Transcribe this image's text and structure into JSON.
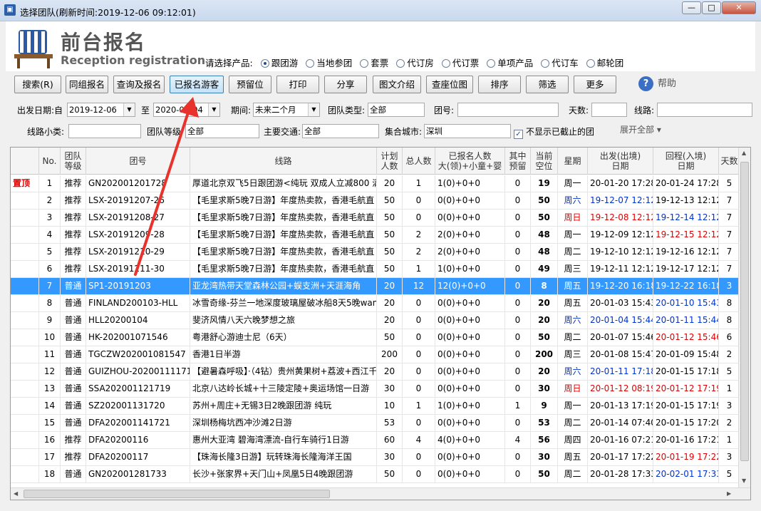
{
  "window": {
    "title": "选择团队(刷新时间:2019-12-06   09:12:01)",
    "min": "—",
    "max": "□",
    "close": "✕"
  },
  "header": {
    "title": "前台报名",
    "subtitle": "Reception registration",
    "product_label": "请选择产品:",
    "products": [
      "跟团游",
      "当地参团",
      "套票",
      "代订房",
      "代订票",
      "单项产品",
      "代订车",
      "邮轮团"
    ]
  },
  "toolbar": {
    "buttons": [
      "搜索(R)",
      "同组报名",
      "查询及报名",
      "已报名游客",
      "预留位",
      "打印",
      "分享",
      "图文介绍",
      "查座位图",
      "排序",
      "筛选",
      "更多"
    ],
    "help": "帮助"
  },
  "filters": {
    "depart_label": "出发日期:自",
    "date_from": "2019-12-06",
    "to_label": "至",
    "date_to": "2020-02-04",
    "period_label": "期间:",
    "period": "未来二个月",
    "team_type_label": "团队类型:",
    "team_type": "全部",
    "team_no_label": "团号:",
    "days_label": "天数:",
    "route_label": "线路:",
    "route_sub_label": "线路小类:",
    "level_label": "团队等级",
    "level": "全部",
    "traffic_label": "主要交通:",
    "traffic": "全部",
    "city_label": "集合城市:",
    "city": "深圳",
    "hide_closed": "不显示已截止的团",
    "expand_all": "展开全部"
  },
  "grid": {
    "headers": [
      "",
      "No.",
      "团队\n等级",
      "团号",
      "线路",
      "计划\n人数",
      "总人数",
      "已报名人数\n大(领)+小童+婴",
      "其中\n预留",
      "当前\n空位",
      "星期",
      "出发(出境)\n日期",
      "回程(入境)\n日期",
      "天数"
    ],
    "rows": [
      [
        "置顶",
        "1",
        "推荐",
        "GN202001201728",
        "厚道北京双飞5日跟团游<纯玩 双成人立减800 满",
        "20",
        "1",
        "1(0)+0+0",
        "0",
        "19",
        "周一",
        "20-01-20 17:28",
        "20-01-24 17:28",
        "5"
      ],
      [
        "",
        "2",
        "推荐",
        "LSX-20191207-26",
        "【毛里求斯5晚7日游】年度热卖款，香港毛航直",
        "50",
        "0",
        "0(0)+0+0",
        "0",
        "50",
        "周六",
        "19-12-07 12:12",
        "19-12-13 12:12",
        "7"
      ],
      [
        "",
        "3",
        "推荐",
        "LSX-20191208-27",
        "【毛里求斯5晚7日游】年度热卖款，香港毛航直",
        "50",
        "0",
        "0(0)+0+0",
        "0",
        "50",
        "周日",
        "19-12-08 12:12",
        "19-12-14 12:12",
        "7"
      ],
      [
        "",
        "4",
        "推荐",
        "LSX-20191209-28",
        "【毛里求斯5晚7日游】年度热卖款，香港毛航直",
        "50",
        "2",
        "2(0)+0+0",
        "0",
        "48",
        "周一",
        "19-12-09 12:12",
        "19-12-15 12:12",
        "7"
      ],
      [
        "",
        "5",
        "推荐",
        "LSX-20191210-29",
        "【毛里求斯5晚7日游】年度热卖款，香港毛航直",
        "50",
        "2",
        "2(0)+0+0",
        "0",
        "48",
        "周二",
        "19-12-10 12:12",
        "19-12-16 12:12",
        "7"
      ],
      [
        "",
        "6",
        "推荐",
        "LSX-20191211-30",
        "【毛里求斯5晚7日游】年度热卖款，香港毛航直",
        "50",
        "1",
        "1(0)+0+0",
        "0",
        "49",
        "周三",
        "19-12-11 12:12",
        "19-12-17 12:12",
        "7"
      ],
      [
        "",
        "7",
        "普通",
        "SP1-20191203",
        "亚龙湾热带天堂森林公园+蜈支洲+天涯海角",
        "20",
        "12",
        "12(0)+0+0",
        "0",
        "8",
        "周五",
        "19-12-20 16:18",
        "19-12-22 16:18",
        "3"
      ],
      [
        "",
        "8",
        "普通",
        "FINLAND200103-HLL",
        "冰雪奇缘-芬兰一地深度玻璃屋破冰船8天5晚wan",
        "20",
        "0",
        "0(0)+0+0",
        "0",
        "20",
        "周五",
        "20-01-03 15:43",
        "20-01-10 15:43",
        "8"
      ],
      [
        "",
        "9",
        "普通",
        "HLL20200104",
        "斐济风情八天六晚梦想之旅",
        "20",
        "0",
        "0(0)+0+0",
        "0",
        "20",
        "周六",
        "20-01-04 15:44",
        "20-01-11 15:44",
        "8"
      ],
      [
        "",
        "10",
        "普通",
        "HK-202001071546",
        "粤港舒心游迪士尼（6天）",
        "50",
        "0",
        "0(0)+0+0",
        "0",
        "50",
        "周二",
        "20-01-07 15:46",
        "20-01-12 15:46",
        "6"
      ],
      [
        "",
        "11",
        "普通",
        "TGCZW202001081547",
        "香港1日半游",
        "200",
        "0",
        "0(0)+0+0",
        "0",
        "200",
        "周三",
        "20-01-08 15:47",
        "20-01-09 15:48",
        "2"
      ],
      [
        "",
        "12",
        "普通",
        "GUIZHOU-2020011117181",
        "【避暑森呼吸】·（4钻）贵州黄果树+荔波+西江千",
        "20",
        "0",
        "0(0)+0+0",
        "0",
        "20",
        "周六",
        "20-01-11 17:18",
        "20-01-15 17:18",
        "5"
      ],
      [
        "",
        "13",
        "普通",
        "SSA202001121719",
        "北京八达岭长城+十三陵定陵+奥运场馆一日游",
        "30",
        "0",
        "0(0)+0+0",
        "0",
        "30",
        "周日",
        "20-01-12 08:19",
        "20-01-12 17:19",
        "1"
      ],
      [
        "",
        "14",
        "普通",
        "SZ202001131720",
        "苏州+周庄+无锡3日2晚跟团游 纯玩",
        "10",
        "1",
        "1(0)+0+0",
        "1",
        "9",
        "周一",
        "20-01-13 17:19",
        "20-01-15 17:19",
        "3"
      ],
      [
        "",
        "15",
        "普通",
        "DFA202001141721",
        "深圳杨梅坑西冲沙滩2日游",
        "53",
        "0",
        "0(0)+0+0",
        "0",
        "53",
        "周二",
        "20-01-14 07:40",
        "20-01-15 17:20",
        "2"
      ],
      [
        "",
        "16",
        "推荐",
        "DFA20200116",
        "惠州大亚湾 碧海湾漂流-自行车骑行1日游",
        "60",
        "4",
        "4(0)+0+0",
        "4",
        "56",
        "周四",
        "20-01-16 07:21",
        "20-01-16 17:21",
        "1"
      ],
      [
        "",
        "17",
        "推荐",
        "DFA20200117",
        "【珠海长隆3日游】玩转珠海长隆海洋王国",
        "30",
        "0",
        "0(0)+0+0",
        "0",
        "30",
        "周五",
        "20-01-17 17:22",
        "20-01-19 17:22",
        "3"
      ],
      [
        "",
        "18",
        "普通",
        "GN202001281733",
        "长沙+张家界+天门山+凤凰5日4晚跟团游",
        "50",
        "0",
        "0(0)+0+0",
        "0",
        "50",
        "周二",
        "20-01-28 17:33",
        "20-02-01 17:33",
        "5"
      ]
    ]
  },
  "colors": {
    "selection": "#3399ff",
    "pin": "#e00000",
    "weekend_blue": "#0033cc",
    "arrow": "#e8322b"
  }
}
